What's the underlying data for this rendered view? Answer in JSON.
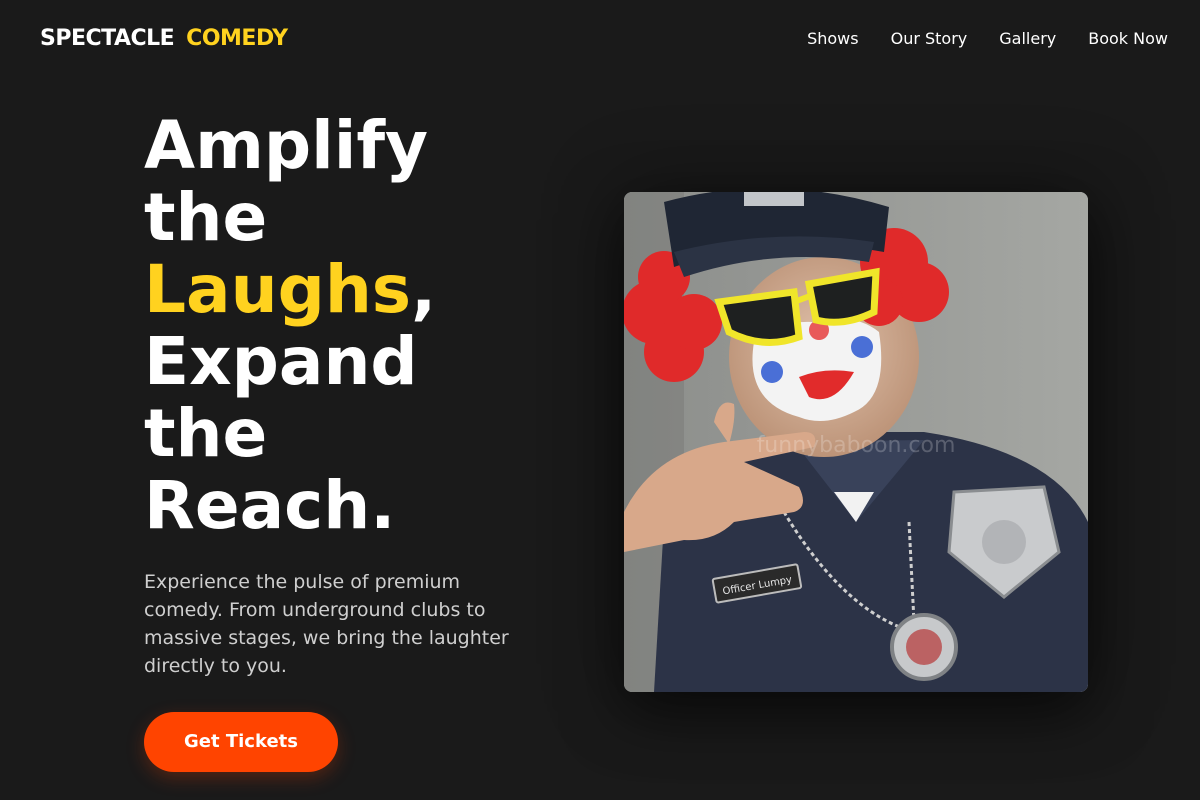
{
  "header": {
    "logo_part_1": "SPECTACLE",
    "logo_part_2": "COMEDY",
    "nav": [
      {
        "label": "Shows"
      },
      {
        "label": "Our Story"
      },
      {
        "label": "Gallery"
      },
      {
        "label": "Book Now"
      }
    ]
  },
  "hero": {
    "title_line_1": "Amplify",
    "title_line_2": "the",
    "title_highlight": "Laughs",
    "title_comma": ",",
    "title_line_4": "Expand",
    "title_line_5": "the",
    "title_line_6": "Reach.",
    "description": "Experience the pulse of premium comedy. From underground clubs to massive stages, we bring the laughter directly to you.",
    "cta_label": "Get Tickets",
    "image": {
      "nametag": "Officer Lumpy",
      "watermark": "funnybaboon.com"
    }
  },
  "colors": {
    "background": "#1a1a1a",
    "accent_yellow": "#ffd21f",
    "accent_orange": "#ff4400",
    "text_primary": "#ffffff",
    "text_secondary": "#cfcfcf"
  }
}
